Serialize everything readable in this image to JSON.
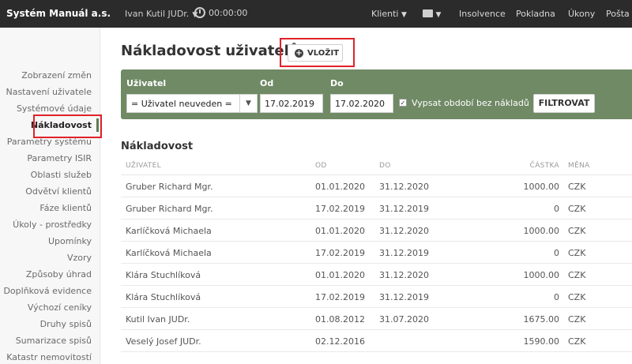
{
  "topbar": {
    "brand": "Systém Manuál a.s.",
    "user": "Ivan Kutil JUDr.",
    "timer": "00:00:00",
    "nav": [
      "Klienti",
      "Insolvence",
      "Pokladna",
      "Úkony",
      "Pošta"
    ]
  },
  "sidebar": {
    "items": [
      "Zobrazení změn",
      "Nastavení uživatele",
      "Systémové údaje",
      "Nákladovost",
      "Parametry systému",
      "Parametry ISIR",
      "Oblasti služeb",
      "Odvětví klientů",
      "Fáze klientů",
      "Úkoly - prostředky",
      "Upomínky",
      "Vzory",
      "Způsoby úhrad",
      "Doplňková evidence",
      "Výchozí ceníky",
      "Druhy spisů",
      "Sumarizace spisů",
      "Katastr nemovitostí"
    ],
    "active": "Nákladovost"
  },
  "page": {
    "title": "Nákladovost uživatelů",
    "add_button": "VLOŽIT"
  },
  "filter": {
    "user_label": "Uživatel",
    "user_value": "= Uživatel neuveden =",
    "from_label": "Od",
    "from_value": "17.02.2019",
    "to_label": "Do",
    "to_value": "17.02.2020",
    "checkbox_label": "Vypsat období bez nákladů",
    "checkbox_checked": true,
    "button": "FILTROVAT"
  },
  "table": {
    "section_title": "Nákladovost",
    "headers": [
      "UŽIVATEL",
      "OD",
      "DO",
      "ČÁSTKA",
      "MĚNA"
    ],
    "rows": [
      {
        "user": "Gruber Richard Mgr.",
        "od": "01.01.2020",
        "do": "31.12.2020",
        "amount": "1000.00",
        "currency": "CZK"
      },
      {
        "user": "Gruber Richard Mgr.",
        "od": "17.02.2019",
        "do": "31.12.2019",
        "amount": "0",
        "currency": "CZK"
      },
      {
        "user": "Karlíčková Michaela",
        "od": "01.01.2020",
        "do": "31.12.2020",
        "amount": "1000.00",
        "currency": "CZK"
      },
      {
        "user": "Karlíčková Michaela",
        "od": "17.02.2019",
        "do": "31.12.2019",
        "amount": "0",
        "currency": "CZK"
      },
      {
        "user": "Klára Stuchlíková",
        "od": "01.01.2020",
        "do": "31.12.2020",
        "amount": "1000.00",
        "currency": "CZK"
      },
      {
        "user": "Klára Stuchlíková",
        "od": "17.02.2019",
        "do": "31.12.2019",
        "amount": "0",
        "currency": "CZK"
      },
      {
        "user": "Kutil Ivan JUDr.",
        "od": "01.08.2012",
        "do": "31.07.2020",
        "amount": "1675.00",
        "currency": "CZK"
      },
      {
        "user": "Veselý Josef JUDr.",
        "od": "02.12.2016",
        "do": "",
        "amount": "1590.00",
        "currency": "CZK"
      }
    ]
  }
}
